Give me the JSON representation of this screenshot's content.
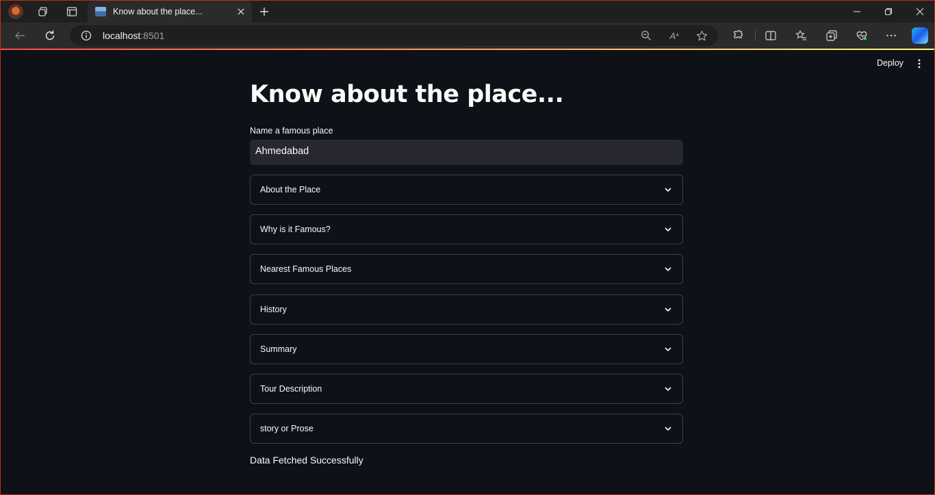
{
  "browser": {
    "tab_title": "Know about the place...",
    "url_host": "localhost",
    "url_port": ":8501"
  },
  "app": {
    "deploy_label": "Deploy",
    "title": "Know about the place...",
    "input_label": "Name a famous place",
    "input_value": "Ahmedabad",
    "expanders": [
      {
        "label": "About the Place"
      },
      {
        "label": "Why is it Famous?"
      },
      {
        "label": "Nearest Famous Places"
      },
      {
        "label": "History"
      },
      {
        "label": "Summary"
      },
      {
        "label": "Tour Description"
      },
      {
        "label": "story or Prose"
      }
    ],
    "status_text": "Data Fetched Successfully"
  }
}
